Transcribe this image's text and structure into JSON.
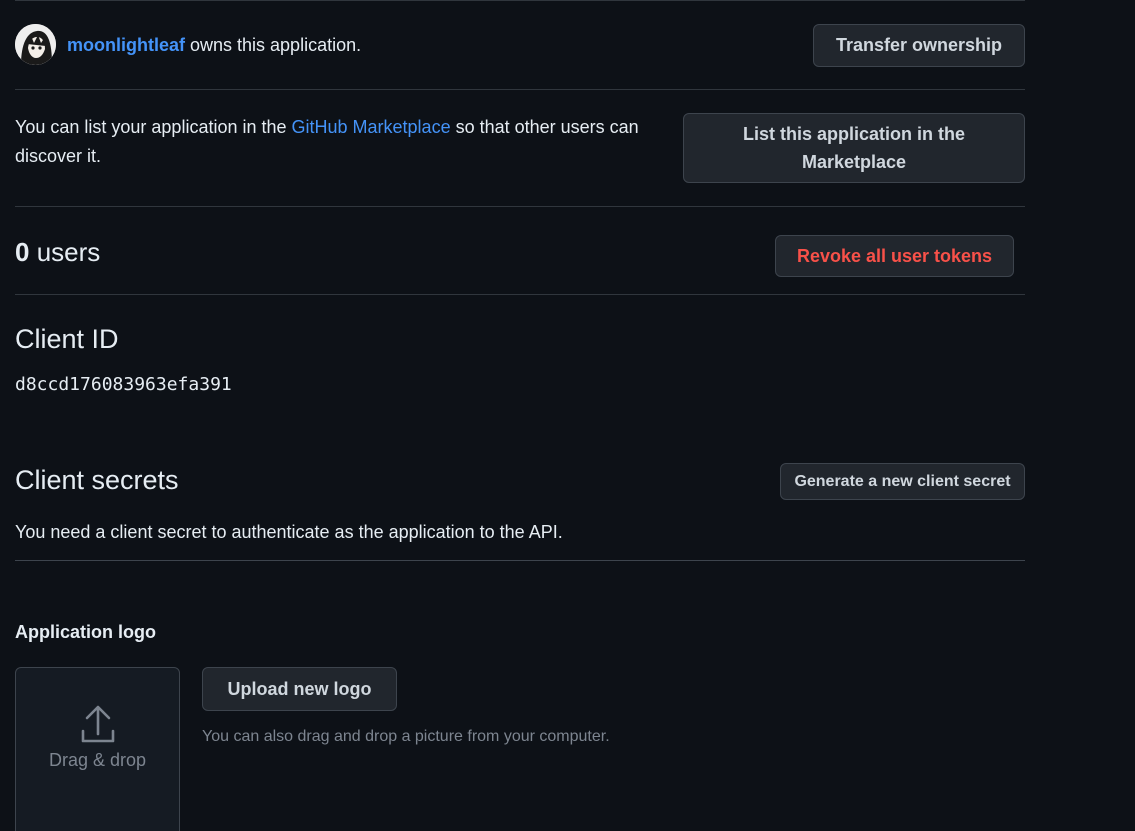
{
  "owner": {
    "username": "moonlightleaf",
    "suffix": " owns this application.",
    "transfer_button": "Transfer ownership"
  },
  "marketplace": {
    "text_before": "You can list your application in the ",
    "link_text": "GitHub Marketplace",
    "text_after": " so that other users can discover it.",
    "list_button_line1": "List this application in the",
    "list_button_line2": "Marketplace"
  },
  "users": {
    "count": "0",
    "label": " users",
    "revoke_button": "Revoke all user tokens"
  },
  "client_id": {
    "heading": "Client ID",
    "value": "d8ccd176083963efa391"
  },
  "client_secrets": {
    "heading": "Client secrets",
    "generate_button": "Generate a new client secret",
    "description": "You need a client secret to authenticate as the application to the API."
  },
  "logo": {
    "heading": "Application logo",
    "dropzone_label": "Drag & drop",
    "upload_button": "Upload new logo",
    "hint": "You can also drag and drop a picture from your computer.",
    "upload_icon": "upload-icon"
  },
  "colors": {
    "background": "#0d1117",
    "border": "#30363d",
    "link": "#4493f8",
    "danger": "#f85149",
    "button_bg": "#21262d"
  }
}
